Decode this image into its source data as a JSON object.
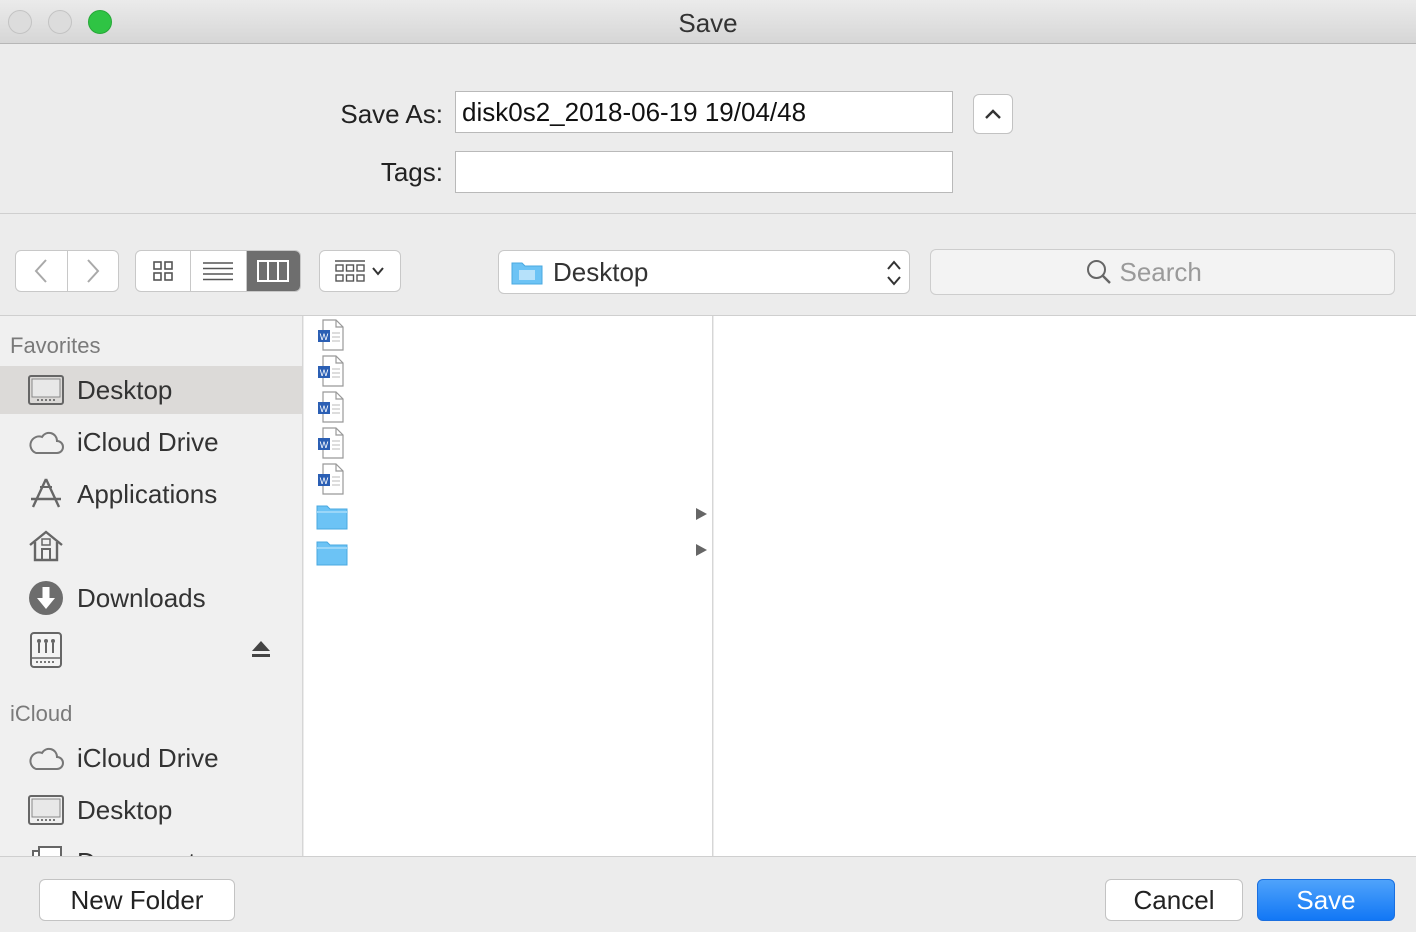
{
  "window": {
    "title": "Save"
  },
  "form": {
    "save_as_label": "Save As:",
    "save_as_value": "disk0s2_2018-06-19 19/04/48",
    "tags_label": "Tags:",
    "tags_value": ""
  },
  "toolbar": {
    "path_label": "Desktop",
    "search_placeholder": "Search",
    "active_view": "columns"
  },
  "sidebar": {
    "favorites_header": "Favorites",
    "favorites": [
      {
        "label": "Desktop",
        "icon": "desktop-icon",
        "selected": true
      },
      {
        "label": "iCloud Drive",
        "icon": "cloud-icon"
      },
      {
        "label": "Applications",
        "icon": "applications-icon"
      },
      {
        "label": "",
        "icon": "home-icon"
      },
      {
        "label": "Downloads",
        "icon": "downloads-icon"
      },
      {
        "label": "",
        "icon": "network-drive-icon",
        "ejectable": true
      }
    ],
    "icloud_header": "iCloud",
    "icloud": [
      {
        "label": "iCloud Drive",
        "icon": "cloud-icon"
      },
      {
        "label": "Desktop",
        "icon": "desktop-icon"
      },
      {
        "label": "Documents",
        "icon": "documents-icon"
      }
    ]
  },
  "files": [
    {
      "type": "word-document",
      "name": ""
    },
    {
      "type": "word-document",
      "name": ""
    },
    {
      "type": "word-document",
      "name": ""
    },
    {
      "type": "word-document",
      "name": ""
    },
    {
      "type": "word-document",
      "name": ""
    },
    {
      "type": "folder",
      "name": ""
    },
    {
      "type": "folder",
      "name": ""
    }
  ],
  "buttons": {
    "new_folder": "New Folder",
    "cancel": "Cancel",
    "save": "Save"
  },
  "colors": {
    "accent": "#1277f5",
    "folder": "#6cc3f5",
    "zoom_light": "#2fc444"
  }
}
